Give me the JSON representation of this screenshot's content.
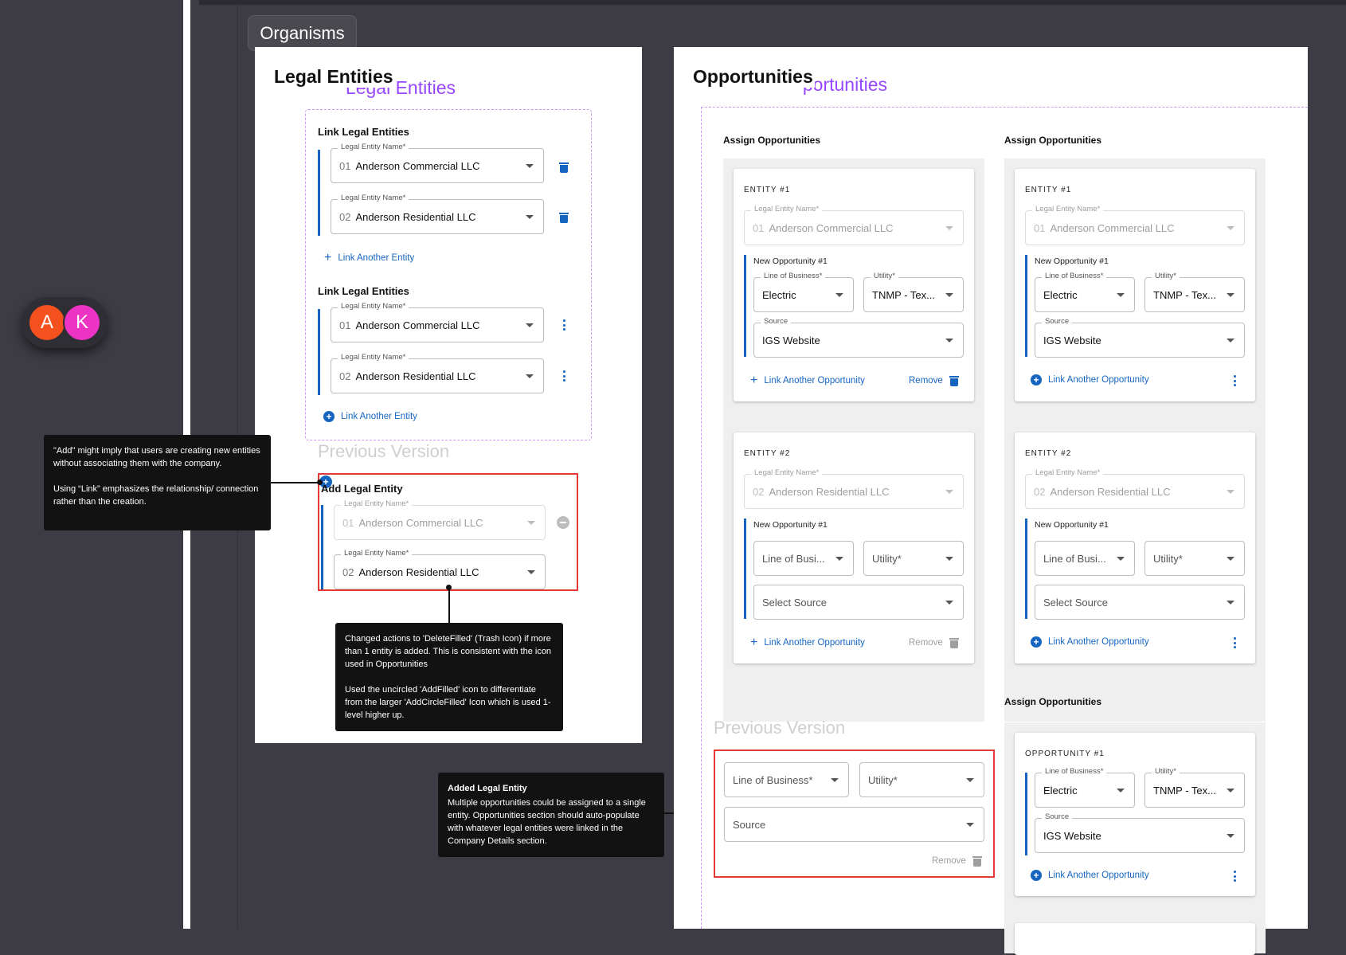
{
  "section_tag": "Organisms",
  "avatars": [
    {
      "initial": "A",
      "color": "#f4511e"
    },
    {
      "initial": "K",
      "color": "#ec33c4"
    }
  ],
  "legal": {
    "title": "Legal Entities",
    "overlay_title": "Legal Entities",
    "group1": {
      "heading": "Link Legal Entities",
      "field_label": "Legal Entity Name*",
      "rows": [
        {
          "num": "01",
          "name": "Anderson Commercial LLC"
        },
        {
          "num": "02",
          "name": "Anderson Residential LLC"
        }
      ],
      "link": "Link Another Entity"
    },
    "group2": {
      "heading": "Link Legal Entities",
      "field_label": "Legal Entity Name*",
      "rows": [
        {
          "num": "01",
          "name": "Anderson Commercial LLC"
        },
        {
          "num": "02",
          "name": "Anderson Residential LLC"
        }
      ],
      "link": "Link Another Entity"
    },
    "previous_label": "Previous Version",
    "previous": {
      "heading": "Add Legal Entity",
      "field_label": "Legal Entity Name*",
      "rows": [
        {
          "num": "01",
          "name": "Anderson Commercial LLC"
        },
        {
          "num": "02",
          "name": "Anderson Residential LLC"
        }
      ]
    }
  },
  "tooltips": {
    "link_note": [
      "\"Add\" might imply that users are creating new entities without  associating them with the company.",
      "Using “Link” emphasizes the relationship/ connection rather than the creation."
    ],
    "delete_note": [
      "Changed actions to 'DeleteFilled' (Trash Icon) if more than 1 entity is added. This is consistent with the icon used in Opportunities",
      "Used the uncircled 'AddFilled' icon to differentiate from the larger 'AddCircleFilled' Icon which is used 1-level higher up."
    ],
    "added_title": "Added Legal Entity",
    "added_body": "Multiple opportunities could be assigned to a single entity. Opportunities section should auto-populate with whatever legal entities were linked in the Company Details section."
  },
  "opp": {
    "title": "Opportunities",
    "overlay_title": "portunities",
    "assign": "Assign Opportunities",
    "entity1": "ENTITY #1",
    "entity2": "ENTITY #2",
    "opportunity1": "OPPORTUNITY #1",
    "legal_label": "Legal Entity Name*",
    "e1_num": "01",
    "e1_name": "Anderson Commercial LLC",
    "e2_num": "02",
    "e2_name": "Anderson Residential LLC",
    "new_opp": "New Opportunity #1",
    "lob_label": "Line of Business*",
    "lob_value": "Electric",
    "lob_placeholder": "Line of Busi...",
    "utility_label": "Utility*",
    "utility_value": "TNMP - Tex...",
    "utility_placeholder": "Utility*",
    "source_label": "Source",
    "source_value": "IGS Website",
    "source_placeholder": "Select Source",
    "link": "Link Another Opportunity",
    "remove": "Remove",
    "previous_label": "Previous Version",
    "prev_lob": "Line of Business*",
    "prev_utility": "Utility*",
    "prev_source": "Source",
    "prev_remove": "Remove"
  }
}
